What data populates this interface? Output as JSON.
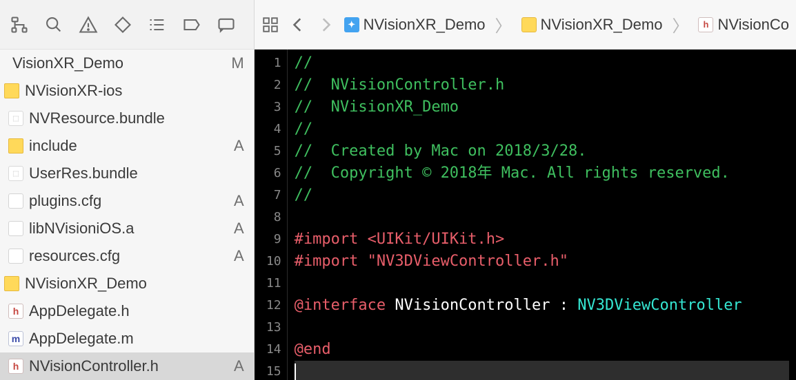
{
  "sidebar": {
    "items": [
      {
        "name": "VisionXR_Demo",
        "badge": "M",
        "icon": "none",
        "indent": 0
      },
      {
        "name": "NVisionXR-ios",
        "badge": "",
        "icon": "folder",
        "indent": 1
      },
      {
        "name": "NVResource.bundle",
        "badge": "",
        "icon": "bundle",
        "indent": 2
      },
      {
        "name": "include",
        "badge": "A",
        "icon": "folder",
        "indent": 2
      },
      {
        "name": "UserRes.bundle",
        "badge": "",
        "icon": "bundle",
        "indent": 2
      },
      {
        "name": "plugins.cfg",
        "badge": "A",
        "icon": "cfg",
        "indent": 2
      },
      {
        "name": "libNVisioniOS.a",
        "badge": "A",
        "icon": "a",
        "indent": 2
      },
      {
        "name": "resources.cfg",
        "badge": "A",
        "icon": "cfg",
        "indent": 2
      },
      {
        "name": "NVisionXR_Demo",
        "badge": "",
        "icon": "folder",
        "indent": 1
      },
      {
        "name": "AppDelegate.h",
        "badge": "",
        "icon": "h",
        "indent": 2
      },
      {
        "name": "AppDelegate.m",
        "badge": "",
        "icon": "m",
        "indent": 2
      },
      {
        "name": "NVisionController.h",
        "badge": "A",
        "icon": "h",
        "indent": 2,
        "selected": true
      }
    ]
  },
  "breadcrumb": {
    "items": [
      {
        "label": "NVisionXR_Demo",
        "icon": "proj"
      },
      {
        "label": "NVisionXR_Demo",
        "icon": "folder"
      },
      {
        "label": "NVisionCo",
        "icon": "h"
      }
    ]
  },
  "code": {
    "lines": [
      {
        "n": 1,
        "type": "c",
        "text": "//"
      },
      {
        "n": 2,
        "type": "c",
        "text": "//  NVisionController.h"
      },
      {
        "n": 3,
        "type": "c",
        "text": "//  NVisionXR_Demo"
      },
      {
        "n": 4,
        "type": "c",
        "text": "//"
      },
      {
        "n": 5,
        "type": "c",
        "text": "//  Created by Mac on 2018/3/28."
      },
      {
        "n": 6,
        "type": "c",
        "text": "//  Copyright © 2018年 Mac. All rights reserved."
      },
      {
        "n": 7,
        "type": "c",
        "text": "//"
      },
      {
        "n": 8,
        "type": "",
        "text": ""
      },
      {
        "n": 9,
        "type": "imp",
        "prefix": "#import ",
        "arg": "<UIKit/UIKit.h>"
      },
      {
        "n": 10,
        "type": "imp",
        "prefix": "#import ",
        "arg": "\"NV3DViewController.h\""
      },
      {
        "n": 11,
        "type": "",
        "text": ""
      },
      {
        "n": 12,
        "type": "iface",
        "kw": "@interface",
        "name": "NVisionController",
        "colon": ":",
        "sup": "NV3DViewController"
      },
      {
        "n": 13,
        "type": "",
        "text": ""
      },
      {
        "n": 14,
        "type": "end",
        "text": "@end"
      },
      {
        "n": 15,
        "type": "cur",
        "text": ""
      }
    ]
  }
}
